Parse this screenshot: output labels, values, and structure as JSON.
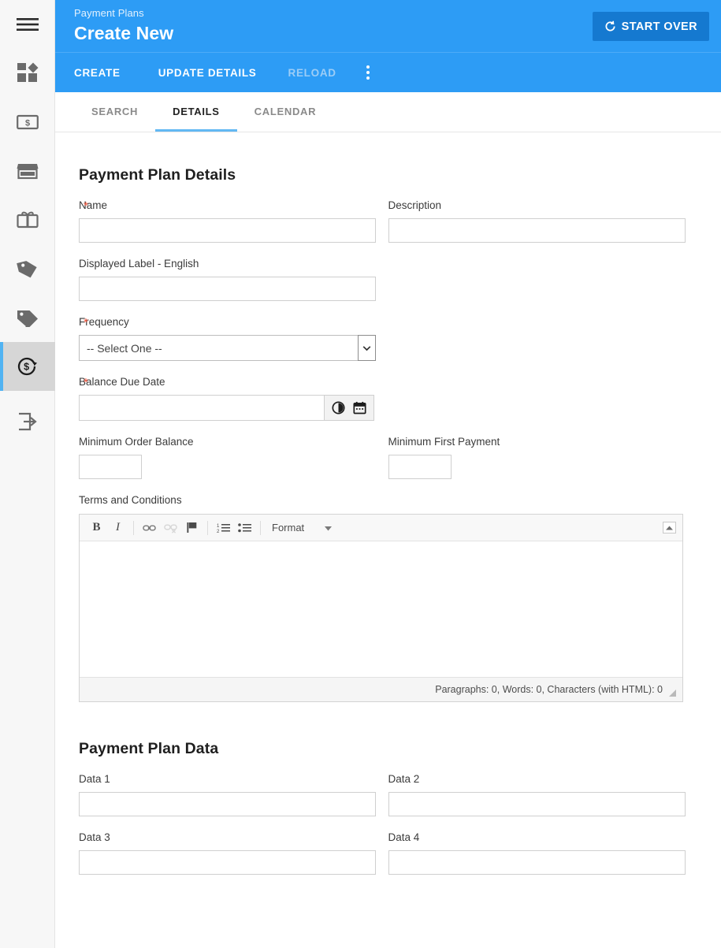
{
  "sidebar": {
    "items": [
      {
        "id": "menu",
        "icon": "hamburger-menu-icon",
        "label": "Menu",
        "active": false
      },
      {
        "id": "dashboard",
        "icon": "dashboard-icon",
        "label": "Dashboard",
        "active": false
      },
      {
        "id": "currency",
        "icon": "banknote-dollar-icon",
        "label": "Currency",
        "active": false
      },
      {
        "id": "store",
        "icon": "storefront-icon",
        "label": "Store",
        "active": false
      },
      {
        "id": "giftcard",
        "icon": "gift-card-icon",
        "label": "Gift Card",
        "active": false
      },
      {
        "id": "price-tag",
        "icon": "price-tag-icon",
        "label": "Price Tag",
        "active": false
      },
      {
        "id": "offers",
        "icon": "tags-icon",
        "label": "Offers",
        "active": false
      },
      {
        "id": "payment-plans",
        "icon": "payment-plan-dollar-refresh-icon",
        "label": "Payment Plans",
        "active": true
      },
      {
        "id": "logout",
        "icon": "logout-arrow-icon",
        "label": "Logout",
        "active": false
      }
    ]
  },
  "header": {
    "eyebrow": "Payment Plans",
    "title": "Create New",
    "start_over_label": "START OVER",
    "start_over_icon": "refresh-icon",
    "bg_color": "#2d9cf5",
    "button_color": "#1579d0"
  },
  "actionbar": {
    "buttons": [
      {
        "label": "CREATE",
        "disabled": false
      },
      {
        "label": "UPDATE DETAILS",
        "disabled": false
      },
      {
        "label": "RELOAD",
        "disabled": true
      }
    ],
    "overflow_icon": "kebab-menu-icon"
  },
  "tabs": [
    {
      "label": "SEARCH",
      "active": false
    },
    {
      "label": "DETAILS",
      "active": true
    },
    {
      "label": "CALENDAR",
      "active": false
    }
  ],
  "details": {
    "section_title": "Payment Plan Details",
    "name": {
      "label": "Name",
      "value": "",
      "required": true
    },
    "description": {
      "label": "Description",
      "value": "",
      "required": false
    },
    "displayed_label_english": {
      "label": "Displayed Label - English",
      "value": "",
      "required": false
    },
    "frequency": {
      "label": "Frequency",
      "selected": "-- Select One --",
      "options": [
        "-- Select One --"
      ],
      "required": true,
      "icon": "chevron-down-icon"
    },
    "balance_due_date": {
      "label": "Balance Due Date",
      "value": "",
      "required": true,
      "icons": [
        "clock-icon",
        "calendar-icon"
      ]
    },
    "minimum_order_balance": {
      "label": "Minimum Order Balance",
      "value": ""
    },
    "minimum_first_payment": {
      "label": "Minimum First Payment",
      "value": ""
    },
    "terms": {
      "label": "Terms and Conditions",
      "value": "",
      "toolbar": [
        {
          "name": "bold",
          "icon": "bold-icon",
          "glyph": "B",
          "disabled": false
        },
        {
          "name": "italic",
          "icon": "italic-icon",
          "glyph": "I",
          "disabled": false
        },
        {
          "name": "link",
          "icon": "link-icon",
          "disabled": false
        },
        {
          "name": "unlink",
          "icon": "unlink-icon",
          "disabled": true
        },
        {
          "name": "anchor",
          "icon": "flag-anchor-icon",
          "disabled": false
        },
        {
          "name": "numbered-list",
          "icon": "numbered-list-icon",
          "disabled": false
        },
        {
          "name": "bulleted-list",
          "icon": "bulleted-list-icon",
          "disabled": false
        }
      ],
      "format_label": "Format",
      "format_icon": "caret-down-icon",
      "collapse_icon": "collapse-up-icon",
      "status": "Paragraphs: 0, Words: 0, Characters (with HTML): 0",
      "resize_icon": "resize-handle-icon"
    }
  },
  "plan_data": {
    "section_title": "Payment Plan Data",
    "fields": [
      {
        "label": "Data 1",
        "value": ""
      },
      {
        "label": "Data 2",
        "value": ""
      },
      {
        "label": "Data 3",
        "value": ""
      },
      {
        "label": "Data 4",
        "value": ""
      }
    ]
  },
  "colors": {
    "accent_blue": "#2d9cf5",
    "tab_underline": "#62b8f3",
    "required_star": "#f4573e",
    "sidebar_bg": "#f7f7f7",
    "sidebar_active": "#d6d6d6"
  }
}
